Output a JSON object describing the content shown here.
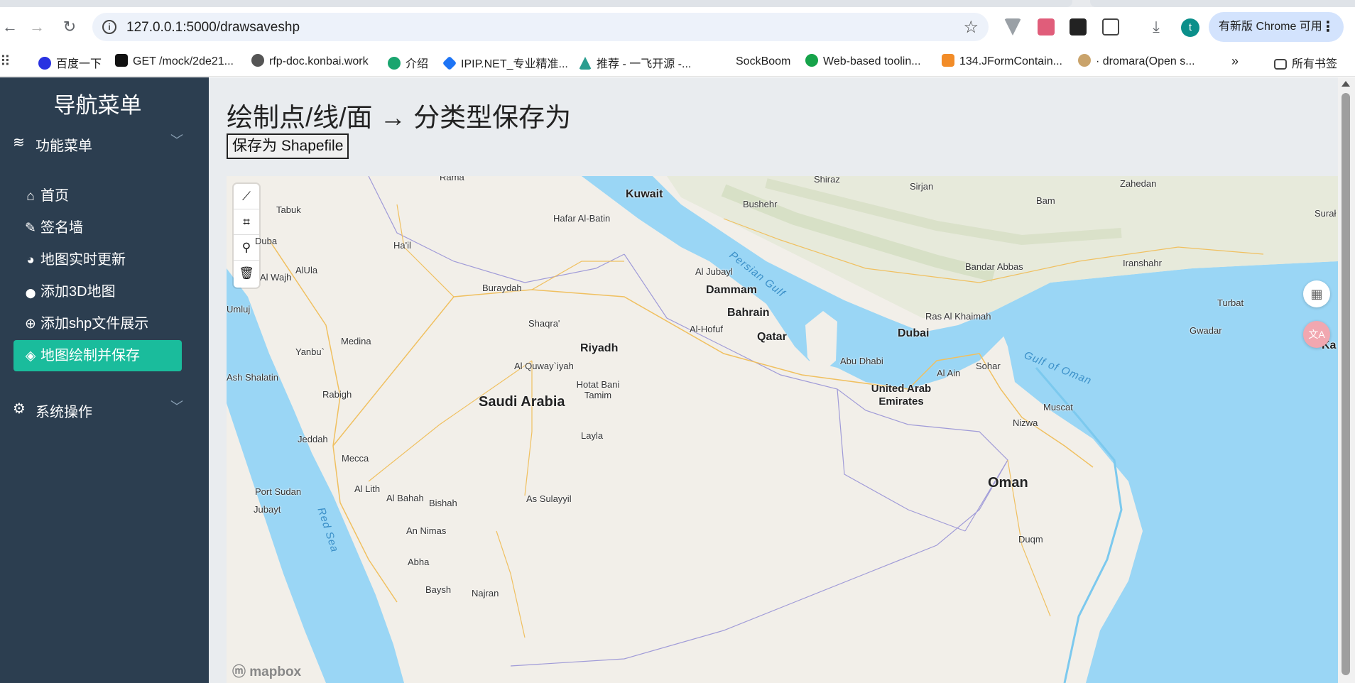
{
  "browser": {
    "url": "127.0.0.1:5000/drawsaveshp",
    "update_label": "有新版 Chrome 可用",
    "avatar_letter": "t",
    "bookmarks": [
      {
        "label": "百度一下",
        "color": "#2932e1"
      },
      {
        "label": "GET /mock/2de21...",
        "color": "#111111"
      },
      {
        "label": "rfp-doc.konbai.work",
        "color": "#555555"
      },
      {
        "label": "介绍",
        "color": "#1aa56f"
      },
      {
        "label": "IPIP.NET_专业精准...",
        "color": "#1d74f5"
      },
      {
        "label": "推荐 - 一飞开源 -...",
        "color": "#2a9d8f"
      },
      {
        "label": "SockBoom",
        "color": "#ffffff"
      },
      {
        "label": "Web-based toolin...",
        "color": "#16a34a"
      },
      {
        "label": "134.JFormContain...",
        "color": "#f28c28"
      },
      {
        "label": "· dromara(Open s...",
        "color": "#c9a36b"
      },
      {
        "label": "所有书签",
        "color": "#444444"
      }
    ]
  },
  "sidebar": {
    "brand": "导航菜单",
    "groups": [
      {
        "label": "功能菜单",
        "icon": "layers-icon"
      },
      {
        "label": "系统操作",
        "icon": "gear-icon"
      }
    ],
    "items": [
      {
        "label": "首页",
        "icon": "home-icon",
        "glyph": "⌂"
      },
      {
        "label": "签名墙",
        "icon": "brush-icon",
        "glyph": "✎"
      },
      {
        "label": "地图实时更新",
        "icon": "palette-icon",
        "glyph": "◕"
      },
      {
        "label": "添加3D地图",
        "icon": "map-marker-icon",
        "glyph": "⬤"
      },
      {
        "label": "添加shp文件展示",
        "icon": "crosshair-icon",
        "glyph": "⊕"
      },
      {
        "label": "地图绘制并保存",
        "icon": "cube-icon",
        "glyph": "◈",
        "active": true
      }
    ]
  },
  "main": {
    "title": "绘制点/线/面 → 分类型保存为",
    "save_button": "保存为 Shapefile"
  },
  "map": {
    "attribution": "mapbox",
    "draw_tools": [
      {
        "name": "draw-line-tool",
        "glyph": "⟋"
      },
      {
        "name": "draw-polygon-tool",
        "glyph": "⌗"
      },
      {
        "name": "draw-point-tool",
        "glyph": "⚲"
      },
      {
        "name": "delete-tool",
        "glyph": "🗑"
      }
    ],
    "labels": [
      {
        "text": "Kuwait",
        "cls": "med"
      },
      {
        "text": "Shiraz",
        "cls": ""
      },
      {
        "text": "Sirjan",
        "cls": ""
      },
      {
        "text": "Zahedan",
        "cls": ""
      },
      {
        "text": "Bam",
        "cls": ""
      },
      {
        "text": "Bushehr",
        "cls": ""
      },
      {
        "text": "Surał",
        "cls": ""
      },
      {
        "text": "Rama",
        "cls": ""
      },
      {
        "text": "Tabuk",
        "cls": ""
      },
      {
        "text": "Hafar Al-Batin",
        "cls": ""
      },
      {
        "text": "Duba",
        "cls": ""
      },
      {
        "text": "Ha'il",
        "cls": ""
      },
      {
        "text": "Al Jubayl",
        "cls": ""
      },
      {
        "text": "Persian Gulf",
        "cls": "sea"
      },
      {
        "text": "Bandar Abbas",
        "cls": ""
      },
      {
        "text": "Iranshahr",
        "cls": ""
      },
      {
        "text": "AlUla",
        "cls": ""
      },
      {
        "text": "Al Wajh",
        "cls": ""
      },
      {
        "text": "Dammam",
        "cls": "med"
      },
      {
        "text": "Buraydah",
        "cls": ""
      },
      {
        "text": "Bahrain",
        "cls": "med"
      },
      {
        "text": "Turbat",
        "cls": ""
      },
      {
        "text": "Umluj",
        "cls": ""
      },
      {
        "text": "Ras Al Khaimah",
        "cls": ""
      },
      {
        "text": "Shaqra'",
        "cls": ""
      },
      {
        "text": "Al-Hofuf",
        "cls": ""
      },
      {
        "text": "Qatar",
        "cls": "med"
      },
      {
        "text": "Gwadar",
        "cls": ""
      },
      {
        "text": "Medina",
        "cls": ""
      },
      {
        "text": "Dubai",
        "cls": "med"
      },
      {
        "text": "Riyadh",
        "cls": "med"
      },
      {
        "text": "Yanbu`",
        "cls": ""
      },
      {
        "text": "Gulf of Oman",
        "cls": "sea"
      },
      {
        "text": "Abu Dhabi",
        "cls": ""
      },
      {
        "text": "Al Quway`iyah",
        "cls": ""
      },
      {
        "text": "Sohar",
        "cls": ""
      },
      {
        "text": "Al Ain",
        "cls": ""
      },
      {
        "text": "Ash Shalatin",
        "cls": ""
      },
      {
        "text": "Hotat Bani Tamim",
        "cls": ""
      },
      {
        "text": "United Arab Emirates",
        "cls": "med"
      },
      {
        "text": "Rabigh",
        "cls": ""
      },
      {
        "text": "Saudi Arabia",
        "cls": "big"
      },
      {
        "text": "Muscat",
        "cls": ""
      },
      {
        "text": "Nizwa",
        "cls": ""
      },
      {
        "text": "Jeddah",
        "cls": ""
      },
      {
        "text": "Layla",
        "cls": ""
      },
      {
        "text": "Mecca",
        "cls": ""
      },
      {
        "text": "Oman",
        "cls": "big"
      },
      {
        "text": "Port Sudan",
        "cls": ""
      },
      {
        "text": "Al Lith",
        "cls": ""
      },
      {
        "text": "Al Bahah",
        "cls": ""
      },
      {
        "text": "Bishah",
        "cls": ""
      },
      {
        "text": "As Sulayyil",
        "cls": ""
      },
      {
        "text": "Jubayt",
        "cls": ""
      },
      {
        "text": "Red Sea",
        "cls": "sea"
      },
      {
        "text": "An Nimas",
        "cls": ""
      },
      {
        "text": "Abha",
        "cls": ""
      },
      {
        "text": "Duqm",
        "cls": ""
      },
      {
        "text": "Baysh",
        "cls": ""
      },
      {
        "text": "Najran",
        "cls": ""
      },
      {
        "text": "Ka",
        "cls": "med"
      }
    ]
  }
}
